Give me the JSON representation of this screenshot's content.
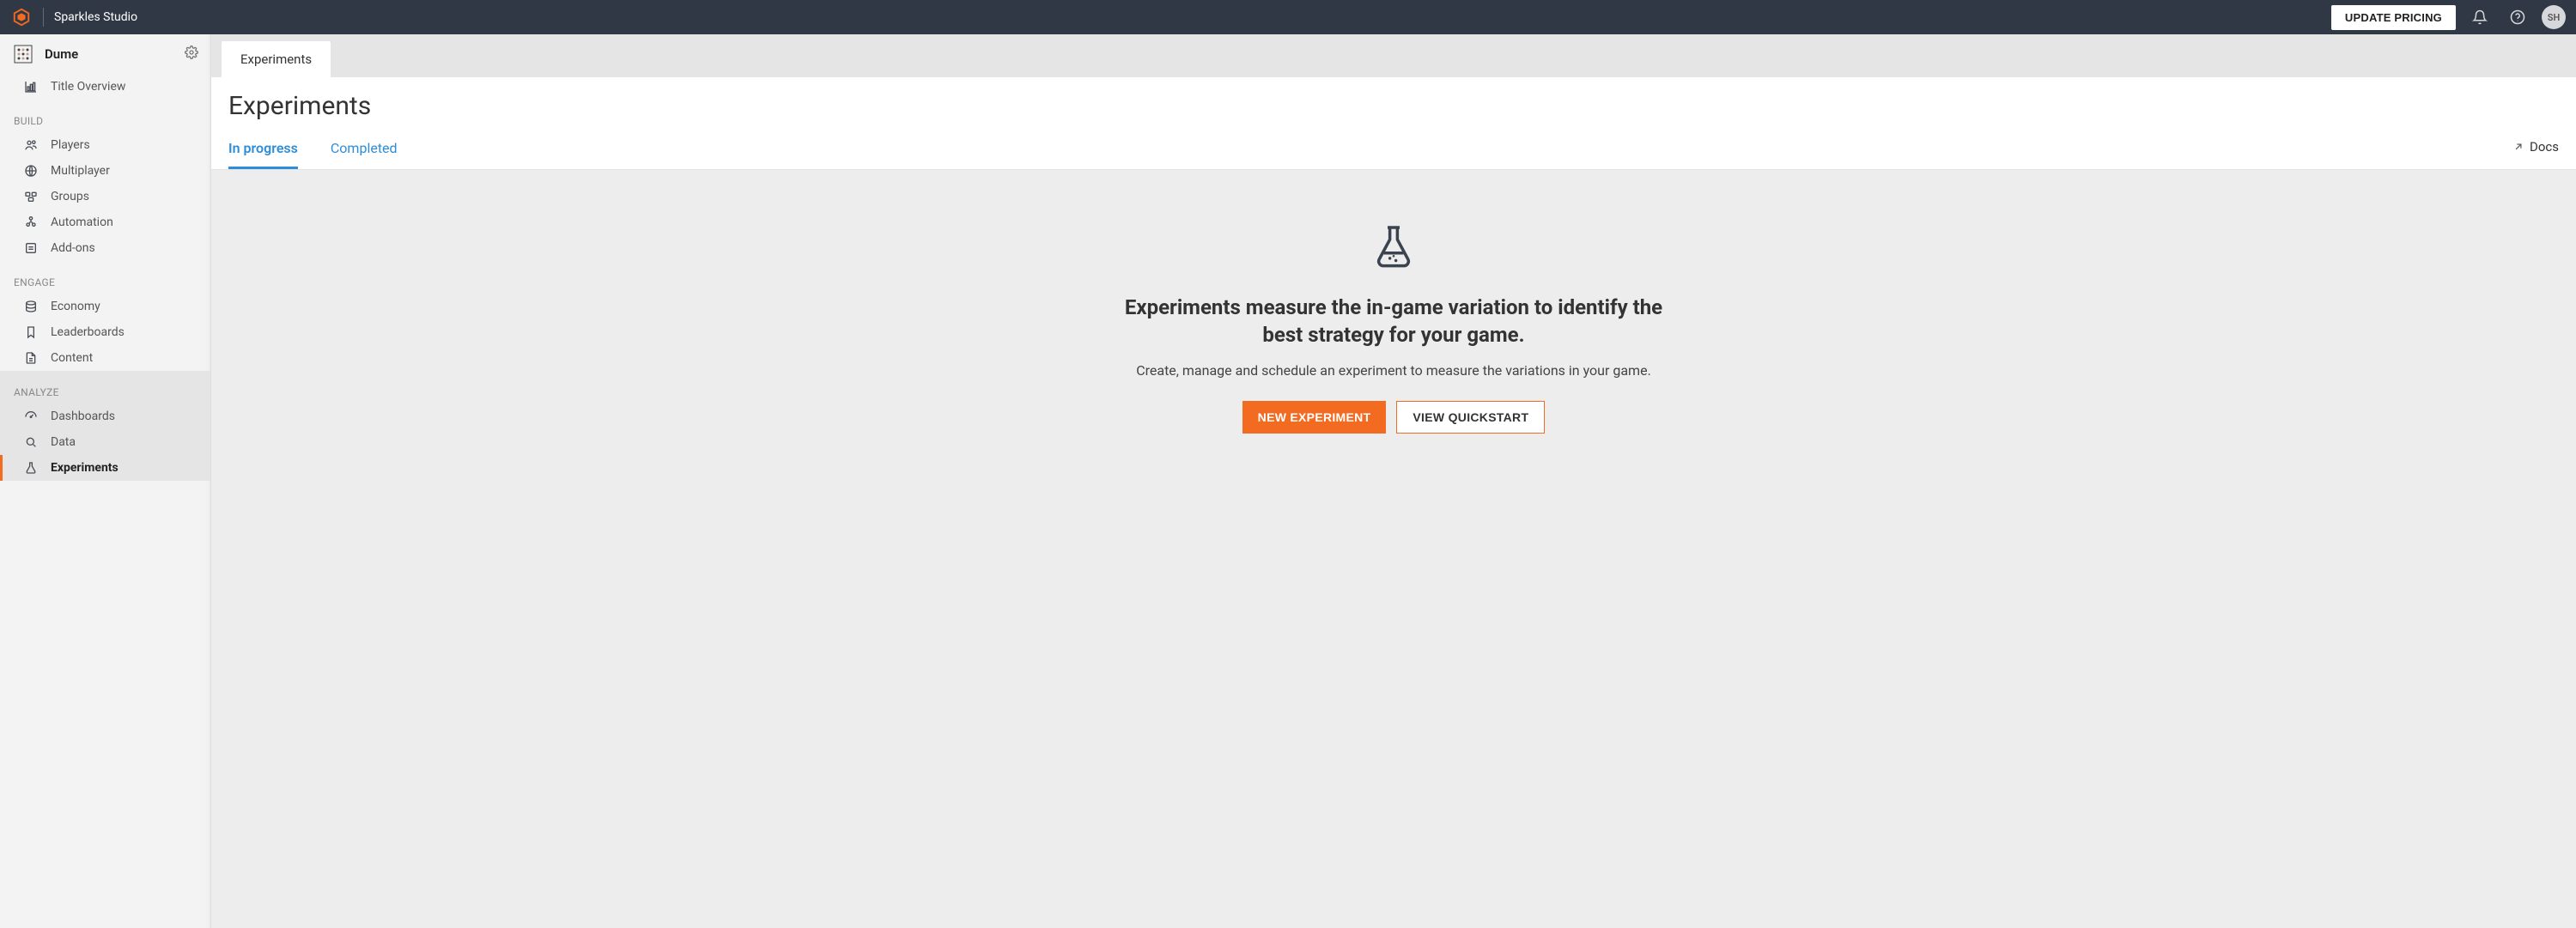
{
  "topbar": {
    "studio_name": "Sparkles Studio",
    "pricing_label": "UPDATE PRICING",
    "avatar_initials": "SH"
  },
  "sidebar": {
    "title_name": "Dume",
    "item_overview": "Title Overview",
    "section_build": "BUILD",
    "item_players": "Players",
    "item_multiplayer": "Multiplayer",
    "item_groups": "Groups",
    "item_automation": "Automation",
    "item_addons": "Add-ons",
    "section_engage": "ENGAGE",
    "item_economy": "Economy",
    "item_leaderboards": "Leaderboards",
    "item_content": "Content",
    "section_analyze": "ANALYZE",
    "item_dashboards": "Dashboards",
    "item_data": "Data",
    "item_experiments": "Experiments"
  },
  "page": {
    "tab_label": "Experiments",
    "heading": "Experiments",
    "subtab_in_progress": "In progress",
    "subtab_completed": "Completed",
    "docs_label": "Docs",
    "empty_heading": "Experiments measure the in-game variation to identify the best strategy for your game.",
    "empty_body": "Create, manage and schedule an experiment to measure the variations in your game.",
    "btn_primary": "NEW EXPERIMENT",
    "btn_secondary": "VIEW QUICKSTART"
  }
}
